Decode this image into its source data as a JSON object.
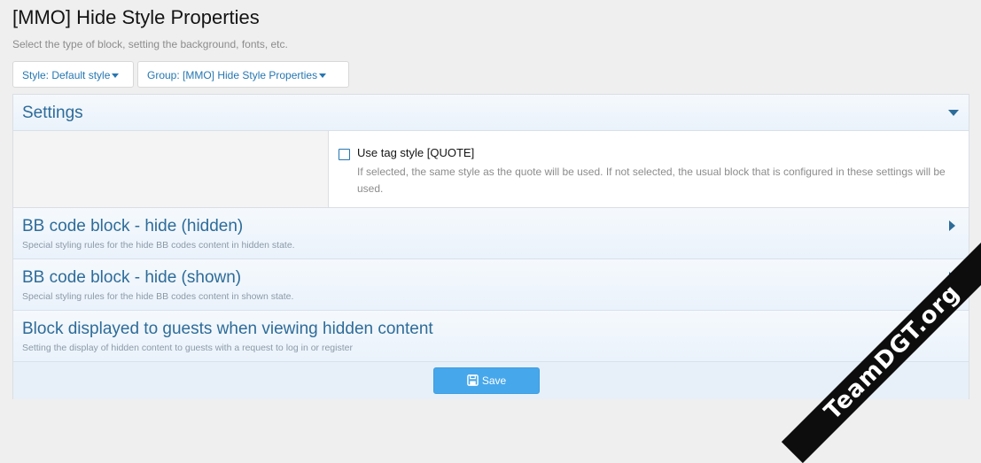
{
  "header": {
    "title": "[MMO] Hide Style Properties",
    "description": "Select the type of block, setting the background, fonts, etc."
  },
  "filters": {
    "style_label": "Style: Default style",
    "group_label": "Group: [MMO] Hide Style Properties"
  },
  "sections": {
    "settings": {
      "title": "Settings",
      "option_label": "Use tag style [QUOTE]",
      "option_hint": "If selected, the same style as the quote will be used. If not selected, the usual block that is configured in these settings will be used.",
      "checked": false
    },
    "hidden": {
      "title": "BB code block - hide (hidden)",
      "subtitle": "Special styling rules for the hide BB codes content in hidden state."
    },
    "shown": {
      "title": "BB code block - hide (shown)",
      "subtitle": "Special styling rules for the hide BB codes content in shown state."
    },
    "guests": {
      "title": "Block displayed to guests when viewing hidden content",
      "subtitle": "Setting the display of hidden content to guests with a request to log in or register"
    }
  },
  "footer": {
    "save_label": "Save"
  },
  "watermark": "TeamDGT.org",
  "colors": {
    "accent": "#2577b1",
    "button": "#47a7eb",
    "heading": "#2d6c99"
  },
  "icons": [
    "caret-down-icon",
    "triangle-down-icon",
    "triangle-right-icon",
    "floppy-disk-icon"
  ]
}
